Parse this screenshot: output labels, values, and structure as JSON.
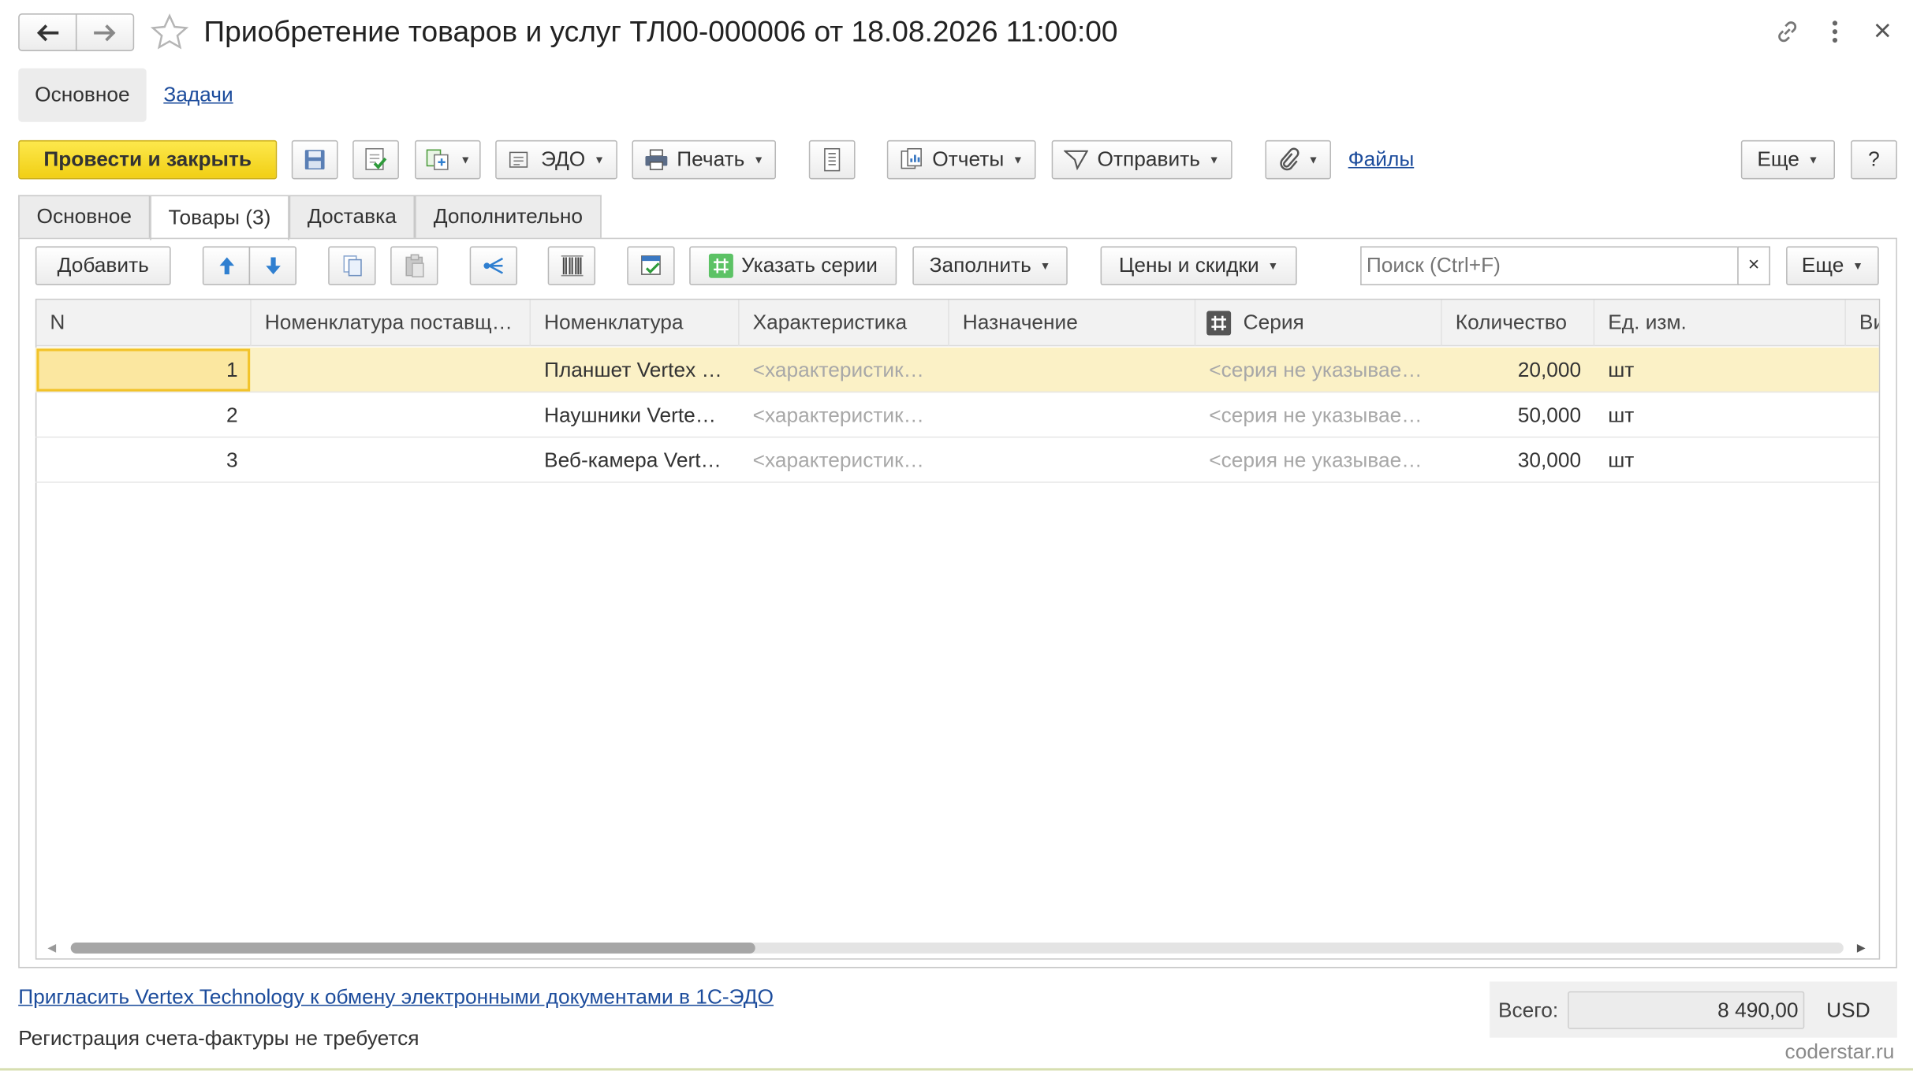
{
  "window": {
    "title": "Приобретение товаров и услуг ТЛ00-000006 от 18.08.2026 11:00:00"
  },
  "top_nav": {
    "main": "Основное",
    "tasks": "Задачи"
  },
  "toolbar": {
    "post_close": "Провести и закрыть",
    "edo": "ЭДО",
    "print": "Печать",
    "reports": "Отчеты",
    "send": "Отправить",
    "files": "Файлы",
    "more": "Еще",
    "help": "?"
  },
  "tabs": [
    {
      "label": "Основное"
    },
    {
      "label": "Товары (3)"
    },
    {
      "label": "Доставка"
    },
    {
      "label": "Дополнительно"
    }
  ],
  "table_toolbar": {
    "add": "Добавить",
    "series": "Указать серии",
    "fill": "Заполнить",
    "prices": "Цены и скидки",
    "search_placeholder": "Поиск (Ctrl+F)",
    "clear": "×",
    "more": "Еще"
  },
  "columns": {
    "n": "N",
    "supplier_item": "Номенклатура поставщ…",
    "item": "Номенклатура",
    "characteristic": "Характеристика",
    "purpose": "Назначение",
    "series": "Серия",
    "qty": "Количество",
    "unit": "Ед. изм.",
    "cut": "Ви"
  },
  "rows": [
    {
      "n": "1",
      "supplier_item": "",
      "item": "Планшет Vertex …",
      "characteristic": "<характеристик…",
      "purpose": "",
      "series": "<серия не указывае…",
      "qty": "20,000",
      "unit": "шт"
    },
    {
      "n": "2",
      "supplier_item": "",
      "item": "Наушники Verte…",
      "characteristic": "<характеристик…",
      "purpose": "",
      "series": "<серия не указывае…",
      "qty": "50,000",
      "unit": "шт"
    },
    {
      "n": "3",
      "supplier_item": "",
      "item": "Веб-камера Vert…",
      "characteristic": "<характеристик…",
      "purpose": "",
      "series": "<серия не указывае…",
      "qty": "30,000",
      "unit": "шт"
    }
  ],
  "footer": {
    "invite_link": "Пригласить Vertex Technology к обмену электронными документами в 1С-ЭДО",
    "invoice_note": "Регистрация счета-фактуры не требуется",
    "total_label": "Всего:",
    "total_value": "8 490,00",
    "currency": "USD",
    "watermark": "coderstar.ru"
  },
  "colors": {
    "accent_yellow": "#f5d926",
    "selected_row": "#fbf1c6",
    "link": "#1c4c9c"
  }
}
